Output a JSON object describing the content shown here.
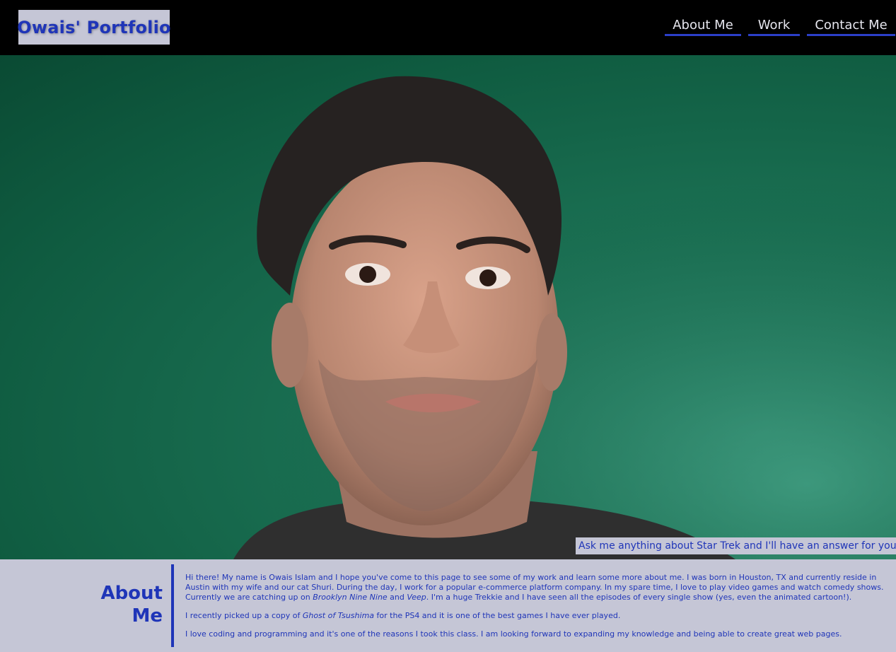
{
  "header": {
    "brand": "Owais' Portfolio",
    "nav": [
      {
        "label": "About Me"
      },
      {
        "label": "Work"
      },
      {
        "label": "Contact Me"
      }
    ]
  },
  "hero": {
    "image": "portrait-photo",
    "caption": "Ask me anything about Star Trek and I'll have an answer for you."
  },
  "about": {
    "heading": "About Me",
    "p1_a": "Hi there! My name is Owais Islam and I hope you've come to this page to see some of my work and learn some more about me. I was born in Houston, TX and currently reside in Austin with my wife and our cat Shuri. During the day, I work for a popular e-commerce platform company. In my spare time, I love to play video games and watch comedy shows. Currently we are catching up on ",
    "p1_show1": "Brooklyn Nine Nine",
    "p1_and": " and ",
    "p1_show2": "Veep",
    "p1_b": ". I'm a huge Trekkie and I have seen all the episodes of every single show (yes, even the animated cartoon!).",
    "p2_a": "I recently picked up a copy of ",
    "p2_game": "Ghost of Tsushima",
    "p2_b": " for the PS4 and it is one of the best games I have ever played.",
    "p3": "I love coding and programming and it's one of the reasons I took this class. I am looking forward to expanding my knowledge and being able to create great web pages."
  },
  "colors": {
    "accent": "#1f35b8",
    "header_bg": "#000000",
    "panel_bg": "#c5c6d6",
    "wall": "#1a6f52"
  }
}
